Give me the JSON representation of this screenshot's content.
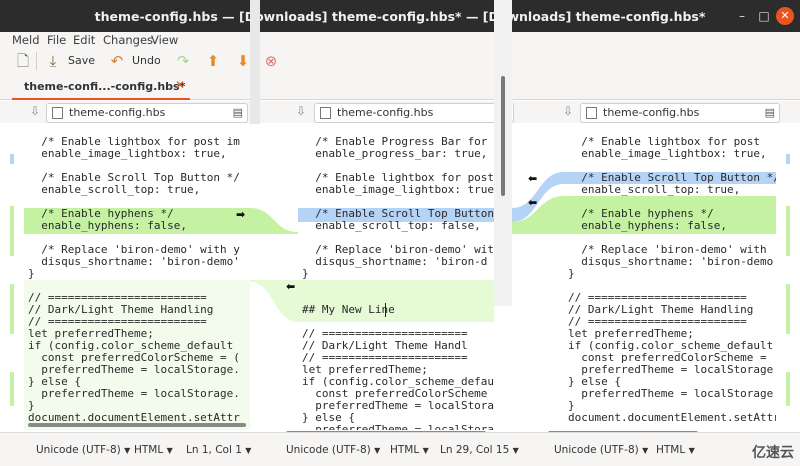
{
  "window": {
    "title": "theme-config.hbs — [Downloads] theme-config.hbs* — [Downloads] theme-config.hbs*"
  },
  "menu": [
    "Meld",
    "File",
    "Edit",
    "Changes",
    "View"
  ],
  "toolbar": {
    "save_label": "Save",
    "undo_label": "Undo"
  },
  "tab": {
    "label": "theme-confi...-config.hbs*"
  },
  "files": [
    {
      "name": "theme-config.hbs"
    },
    {
      "name": "theme-config.hbs"
    },
    {
      "name": "theme-config.hbs"
    }
  ],
  "panes": {
    "left": [
      "  /* Enable lightbox for post im",
      "  enable_image_lightbox: true,",
      "",
      "  /* Enable Scroll Top Button */",
      "  enable_scroll_top: true,",
      "",
      "  /* Enable hyphens */",
      "  enable_hyphens: false,",
      "",
      "  /* Replace 'biron-demo' with y",
      "  disqus_shortname: 'biron-demo'",
      "}",
      "",
      "// ========================",
      "// Dark/Light Theme Handling",
      "// ========================",
      "let preferredTheme;",
      "if (config.color_scheme_default",
      "  const preferredColorScheme = (",
      "  preferredTheme = localStorage.",
      "} else {",
      "  preferredTheme = localStorage.",
      "}",
      "document.documentElement.setAttr"
    ],
    "middle": [
      "  /* Enable Progress Bar for p",
      "  enable_progress_bar: true,",
      "",
      "  /* Enable lightbox for post",
      "  enable_image_lightbox: true",
      "",
      "  /* Enable Scroll Top Button",
      "  enable_scroll_top: false,",
      "",
      "  /* Replace 'biron-demo' wit",
      "  disqus_shortname: 'biron-d",
      "}",
      "",
      "",
      "## My New Line",
      "",
      "// ======================",
      "// Dark/Light Theme Handl",
      "// ======================",
      "let preferredTheme;",
      "if (config.color_scheme_defau",
      "  const preferredColorScheme",
      "  preferredTheme = localStora",
      "} else {",
      "  preferredTheme = localStora"
    ],
    "right": [
      "  /* Enable lightbox for post",
      "  enable_image_lightbox: true,",
      "",
      "  /* Enable Scroll Top Button */",
      "  enable_scroll_top: true,",
      "",
      "  /* Enable hyphens */",
      "  enable_hyphens: false,",
      "",
      "  /* Replace 'biron-demo' with",
      "  disqus_shortname: 'biron-demo",
      "}",
      "",
      "// ========================",
      "// Dark/Light Theme Handling",
      "// ========================",
      "let preferredTheme;",
      "if (config.color_scheme_default",
      "  const preferredColorScheme =",
      "  preferredTheme = localStorage",
      "} else {",
      "  preferredTheme = localStorage",
      "}",
      "document.documentElement.setAttr"
    ]
  },
  "status": [
    {
      "encoding": "Unicode (UTF-8)",
      "syntax": "HTML",
      "position": "Ln 1, Col 1"
    },
    {
      "encoding": "Unicode (UTF-8)",
      "syntax": "HTML",
      "position": "Ln 29, Col 15"
    },
    {
      "encoding": "Unicode (UTF-8)",
      "syntax": "HTML",
      "position": ""
    }
  ],
  "watermark": "亿速云",
  "colors": {
    "insert": "#c5f2a2",
    "change": "#b4d3f5",
    "accent": "#e95420"
  }
}
